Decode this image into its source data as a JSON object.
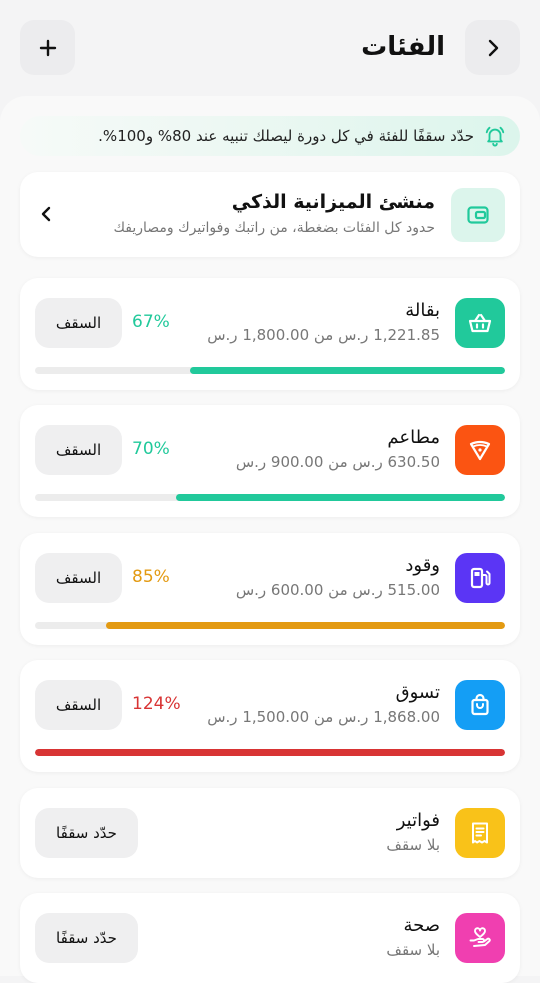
{
  "header": {
    "title": "الفئات",
    "back_icon": "chevron-right-icon",
    "add_icon": "plus-icon"
  },
  "banner": {
    "icon": "bell-icon",
    "text": "حدّد سقفًا للفئة في كل دورة ليصلك تنبيه عند 80% و100%."
  },
  "smart_builder": {
    "icon": "wallet-icon",
    "title": "منشئ الميزانية الذكي",
    "subtitle": "حدود كل الفئات بضغطة، من راتبك وفواتيرك ومصاريفك",
    "chevron_icon": "chevron-left-icon"
  },
  "colors": {
    "green": "#21c99b",
    "orange": "#e39a12",
    "red": "#d83434"
  },
  "categories": [
    {
      "name": "بقالة",
      "subtitle": "1,221.85 ر.س من 1,800.00 ر.س",
      "percent": "67%",
      "progress": 0.67,
      "button": "السقف",
      "icon": "basket-icon",
      "icon_color": "#21c99b",
      "bar_color": "#21c99b",
      "pct_color": "#21c99b"
    },
    {
      "name": "مطاعم",
      "subtitle": "630.50 ر.س من 900.00 ر.س",
      "percent": "70%",
      "progress": 0.7,
      "button": "السقف",
      "icon": "pizza-icon",
      "icon_color": "#fb5412",
      "bar_color": "#21c99b",
      "pct_color": "#21c99b"
    },
    {
      "name": "وقود",
      "subtitle": "515.00 ر.س من 600.00 ر.س",
      "percent": "85%",
      "progress": 0.85,
      "button": "السقف",
      "icon": "fuel-icon",
      "icon_color": "#5b35f5",
      "bar_color": "#e39a12",
      "pct_color": "#e39a12"
    },
    {
      "name": "تسوق",
      "subtitle": "1,868.00 ر.س من 1,500.00 ر.س",
      "percent": "124%",
      "progress": 1.0,
      "button": "السقف",
      "icon": "shopping-bag-icon",
      "icon_color": "#149ef5",
      "bar_color": "#d83434",
      "pct_color": "#d83434"
    },
    {
      "name": "فواتير",
      "subtitle": "بلا سقف",
      "button": "حدّد سقفًا",
      "icon": "receipt-icon",
      "icon_color": "#f9c219"
    },
    {
      "name": "صحة",
      "subtitle": "بلا سقف",
      "button": "حدّد سقفًا",
      "icon": "hand-heart-icon",
      "icon_color": "#f03fb0"
    }
  ]
}
